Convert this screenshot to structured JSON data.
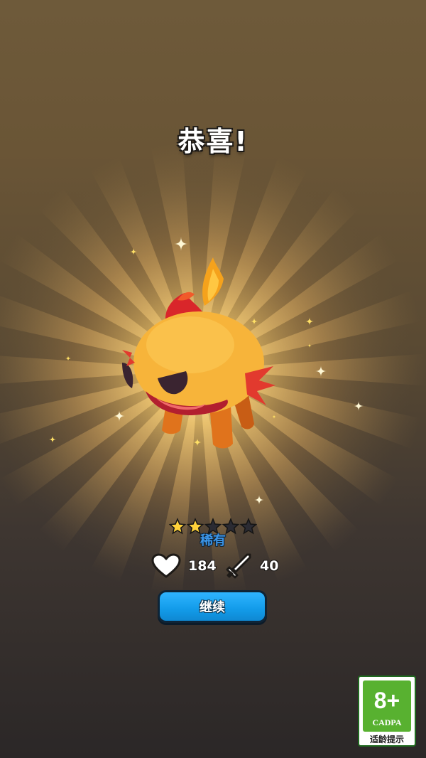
{
  "screen": {
    "title": "恭喜!"
  },
  "pet": {
    "star_rating": 2,
    "star_max": 5,
    "rarity": "稀有"
  },
  "stats": {
    "hp": "184",
    "attack": "40"
  },
  "actions": {
    "continue_label": "继续"
  },
  "age_rating": {
    "age": "8+",
    "org": "CADPA",
    "caption": "适龄提示"
  },
  "colors": {
    "button_blue": "#1aa3f0",
    "rarity_blue": "#3b95e8",
    "star_filled": "#ffd23a",
    "star_empty": "#2b2b33",
    "age_green": "#58b130"
  },
  "icons": {
    "hp": "heart-icon",
    "attack": "sword-icon"
  }
}
